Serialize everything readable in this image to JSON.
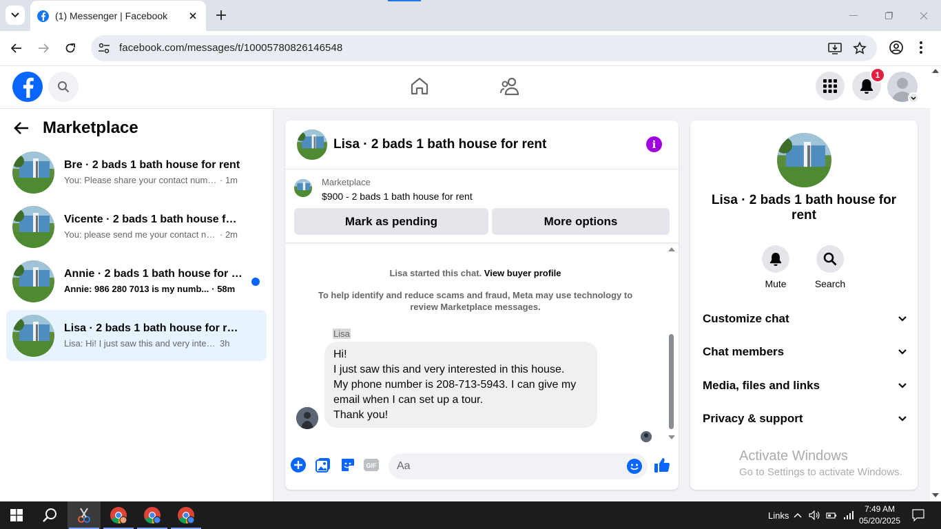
{
  "browser": {
    "tab_title": "(1) Messenger | Facebook",
    "url": "facebook.com/messages/t/10005780826146548"
  },
  "facebook": {
    "notification_count": "1",
    "accent": "#0866ff"
  },
  "left": {
    "title": "Marketplace",
    "conversations": [
      {
        "name": "Bre · 2 bads 1 bath house for rent",
        "preview": "You: Please share your contact numb...",
        "time": "· 1m",
        "unread": false
      },
      {
        "name": "Vicente · 2 bads 1 bath house for r...",
        "preview": "You: please send me your contact nu...",
        "time": "· 2m",
        "unread": false
      },
      {
        "name": "Annie · 2 bads 1 bath house for r...",
        "preview": "Annie: 986 280 7013 is my numb...",
        "time": "· 58m",
        "unread": true
      },
      {
        "name": "Lisa · 2 bads 1 bath house for rent",
        "preview": "Lisa: Hi! I just saw this and very interes...",
        "time": "3h",
        "unread": false
      }
    ]
  },
  "chat": {
    "header_name": "Lisa · 2 bads 1 bath house for rent",
    "listing_source": "Marketplace",
    "listing_price": "$900 - 2 bads 1 bath house for rent",
    "mark_pending": "Mark as pending",
    "more_options": "More options",
    "started_text": "Lisa started this chat.",
    "view_profile": "View buyer profile",
    "notice": "To help identify and reduce scams and fraud, Meta may use technology to review Marketplace messages.",
    "sender": "Lisa",
    "message_lines": [
      "Hi!",
      "I just saw this and very interested in this house.",
      "My phone number is 208-713-5943. I can give my",
      "email when I can set up a tour.",
      "Thank you!"
    ],
    "input_placeholder": "Aa"
  },
  "right": {
    "name": "Lisa · 2 bads 1 bath house for rent",
    "mute": "Mute",
    "search": "Search",
    "sections": [
      "Customize chat",
      "Chat members",
      "Media, files and links",
      "Privacy & support"
    ]
  },
  "watermark": {
    "line1": "Activate Windows",
    "line2": "Go to Settings to activate Windows."
  },
  "taskbar": {
    "links": "Links",
    "time": "7:49 AM",
    "date": "05/20/2025"
  }
}
